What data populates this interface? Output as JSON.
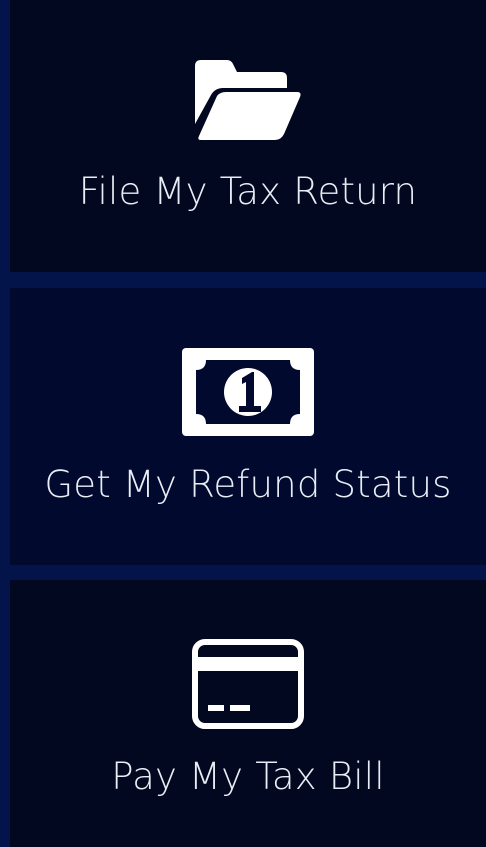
{
  "tiles": [
    {
      "label": "File My Tax Return",
      "icon": "folder-open-icon"
    },
    {
      "label": "Get My Refund Status",
      "icon": "money-bill-icon"
    },
    {
      "label": "Pay My Tax Bill",
      "icon": "credit-card-icon"
    }
  ],
  "colors": {
    "background": "#03144a",
    "tile_dark": "#02081f",
    "tile_navy": "#010a2e",
    "text": "#e9edf5",
    "icon": "#ffffff"
  }
}
